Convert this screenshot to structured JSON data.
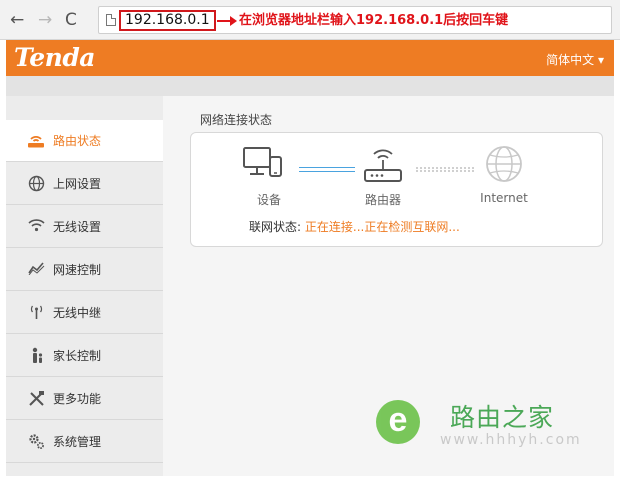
{
  "browser": {
    "url": "192.168.0.1",
    "annotation": "在浏览器地址栏输入192.168.0.1后按回车键"
  },
  "header": {
    "logo": "Tenda",
    "language": "简体中文",
    "brand_color": "#ee7c23"
  },
  "sidebar": {
    "items": [
      {
        "label": "路由状态",
        "icon": "router-status-icon",
        "active": true
      },
      {
        "label": "上网设置",
        "icon": "globe-icon",
        "active": false
      },
      {
        "label": "无线设置",
        "icon": "wifi-icon",
        "active": false
      },
      {
        "label": "网速控制",
        "icon": "speed-chart-icon",
        "active": false
      },
      {
        "label": "无线中继",
        "icon": "antenna-icon",
        "active": false
      },
      {
        "label": "家长控制",
        "icon": "parent-child-icon",
        "active": false
      },
      {
        "label": "更多功能",
        "icon": "tools-icon",
        "active": false
      },
      {
        "label": "系统管理",
        "icon": "gears-icon",
        "active": false
      }
    ]
  },
  "main": {
    "panel_title": "网络连接状态",
    "devices": {
      "device_label": "设备",
      "router_label": "路由器",
      "internet_label": "Internet"
    },
    "status_label": "联网状态:",
    "status_value": "正在连接...正在检测互联网..."
  },
  "watermark": {
    "name": "路由之家",
    "url": "www.hhhyh.com"
  }
}
